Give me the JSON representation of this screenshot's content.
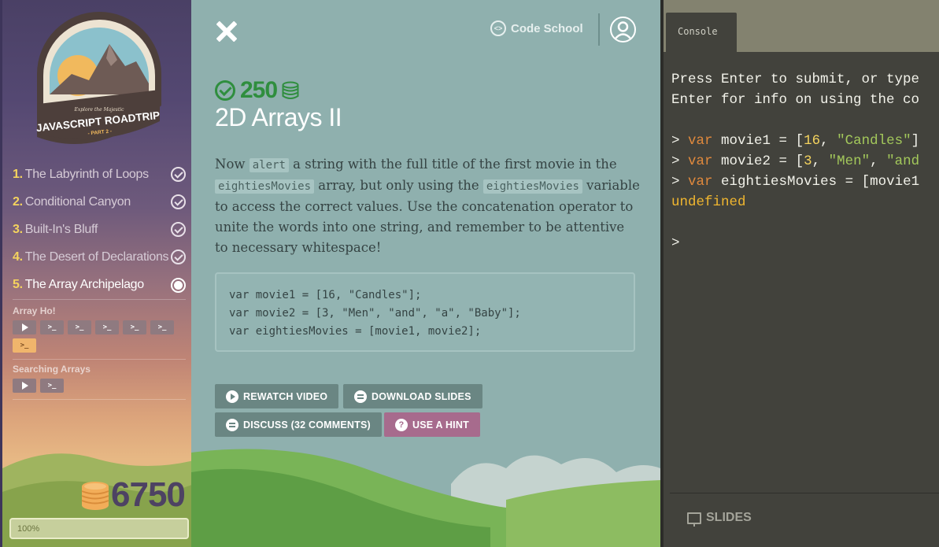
{
  "sidebar": {
    "badge": {
      "tagline": "Explore the Majestic",
      "course_name": "JAVASCRIPT ROADTRIP",
      "part": "- PART 2 -"
    },
    "levels": [
      {
        "num": "1.",
        "title": "The Labyrinth of Loops",
        "status": "complete"
      },
      {
        "num": "2.",
        "title": "Conditional Canyon",
        "status": "complete"
      },
      {
        "num": "3.",
        "title": "Built-In's Bluff",
        "status": "complete"
      },
      {
        "num": "4.",
        "title": "The Desert of Declarations",
        "status": "complete"
      },
      {
        "num": "5.",
        "title": "The Array Archipelago",
        "status": "current"
      }
    ],
    "sections": [
      {
        "title": "Array Ho!",
        "steps": [
          "video",
          "challenge",
          "challenge",
          "challenge",
          "challenge",
          "challenge",
          "challenge-active"
        ]
      },
      {
        "title": "Searching Arrays",
        "steps": [
          "video",
          "challenge"
        ]
      }
    ],
    "total_points": "6750",
    "progress_label": "100%",
    "progress_value": 1.0
  },
  "header": {
    "close_icon": "close-icon",
    "brand": "Code School",
    "avatar_icon": "user-avatar-icon"
  },
  "challenge": {
    "points": "250",
    "title": "2D Arrays II",
    "desc": {
      "t1": "Now ",
      "c1": "alert",
      "t2": " a string with the full title of the first movie in the ",
      "c2": "eightiesMovies",
      "t3": " array, but only using the ",
      "c3": "eightiesMovies",
      "t4": " variable to access the correct values. Use the concatenation operator to unite the words into one string, and remember to be attentive to necessary whitespace!"
    },
    "code_lines": [
      "var movie1 = [16, \"Candles\"];",
      "var movie2 = [3, \"Men\", \"and\", \"a\", \"Baby\"];",
      "var eightiesMovies = [movie1, movie2];"
    ],
    "buttons": {
      "rewatch": "REWATCH VIDEO",
      "download": "DOWNLOAD SLIDES",
      "discuss": "DISCUSS (32 COMMENTS)",
      "hint": "USE A HINT"
    }
  },
  "console": {
    "tab_label": "Console",
    "intro1": "Press Enter to submit, or type",
    "intro2": "Enter for info on using the co",
    "prompt": ">",
    "lines": [
      {
        "kw": "var",
        "name": " movie1 = [",
        "n1": "16",
        "sep1": ", ",
        "s1": "\"Candles\"",
        "rest": "]"
      },
      {
        "kw": "var",
        "name": " movie2 = [",
        "n1": "3",
        "sep1": ", ",
        "s1": "\"Men\"",
        "rest": ", ",
        "s2": "\"and"
      },
      {
        "kw": "var",
        "name": " eightiesMovies = [movie1",
        "rest": ""
      }
    ],
    "result": "undefined",
    "footer_label": "SLIDES"
  },
  "colors": {
    "accent_green": "#2f8e3e",
    "hint_pink": "#a76b8d",
    "button_grey": "#6a8683"
  }
}
